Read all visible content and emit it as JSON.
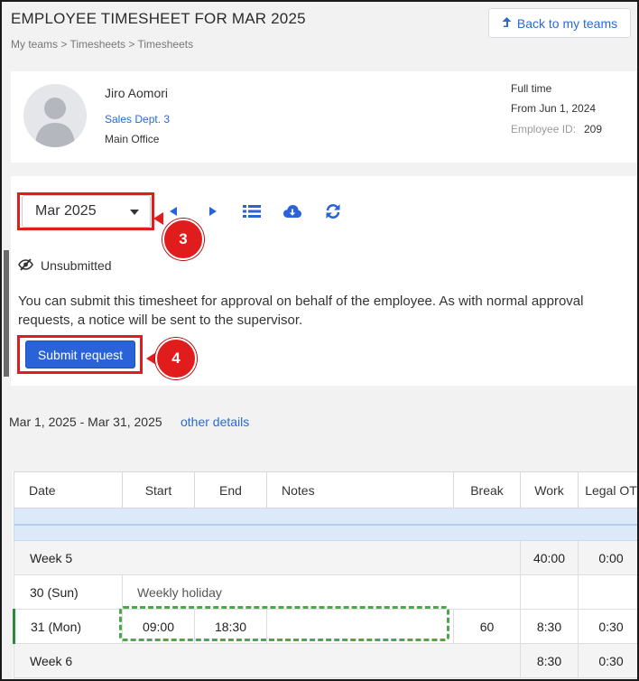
{
  "header": {
    "title": "EMPLOYEE TIMESHEET FOR MAR 2025",
    "breadcrumb": "My teams > Timesheets > Timesheets",
    "back_label": "Back to my teams"
  },
  "employee": {
    "name": "Jiro Aomori",
    "department": "Sales Dept. 3",
    "office": "Main Office",
    "employment_type": "Full time",
    "from_date": "From Jun 1, 2024",
    "id_label": "Employee ID:",
    "id": "209"
  },
  "controls": {
    "month": "Mar 2025",
    "icons": [
      "previous-month-icon",
      "next-month-icon",
      "list-icon",
      "cloud-download-icon",
      "refresh-icon"
    ]
  },
  "callouts": {
    "select": "3",
    "submit": "4"
  },
  "status": {
    "label": "Unsubmitted",
    "note_line1": "You can submit this timesheet for approval on behalf of the employee. As with normal approval",
    "note_line2": "requests, a notice will be sent to the supervisor.",
    "submit_label": "Submit request"
  },
  "period": {
    "range": "Mar 1, 2025 - Mar 31, 2025",
    "other_details": "other details"
  },
  "table": {
    "headers": [
      "Date",
      "Start",
      "End",
      "Notes",
      "Break",
      "Work",
      "Legal OT"
    ],
    "rows": [
      {
        "kind": "week",
        "label": "Week 5",
        "work": "40:00",
        "legal_ot": "0:00"
      },
      {
        "kind": "day",
        "date": "30 (Sun)",
        "note": "Weekly holiday"
      },
      {
        "kind": "day",
        "date": "31 (Mon)",
        "start": "09:00",
        "end": "18:30",
        "break": "60",
        "work": "8:30",
        "legal_ot": "0:30"
      },
      {
        "kind": "week",
        "label": "Week 6",
        "work": "8:30",
        "legal_ot": "0:30"
      }
    ]
  },
  "colors": {
    "accent": "#2a69d6",
    "submit_button": "#2a62d8",
    "annotation_red": "#e21b1b",
    "annotation_green": "#4aa84a",
    "monday_green": "#2e8b3e"
  }
}
